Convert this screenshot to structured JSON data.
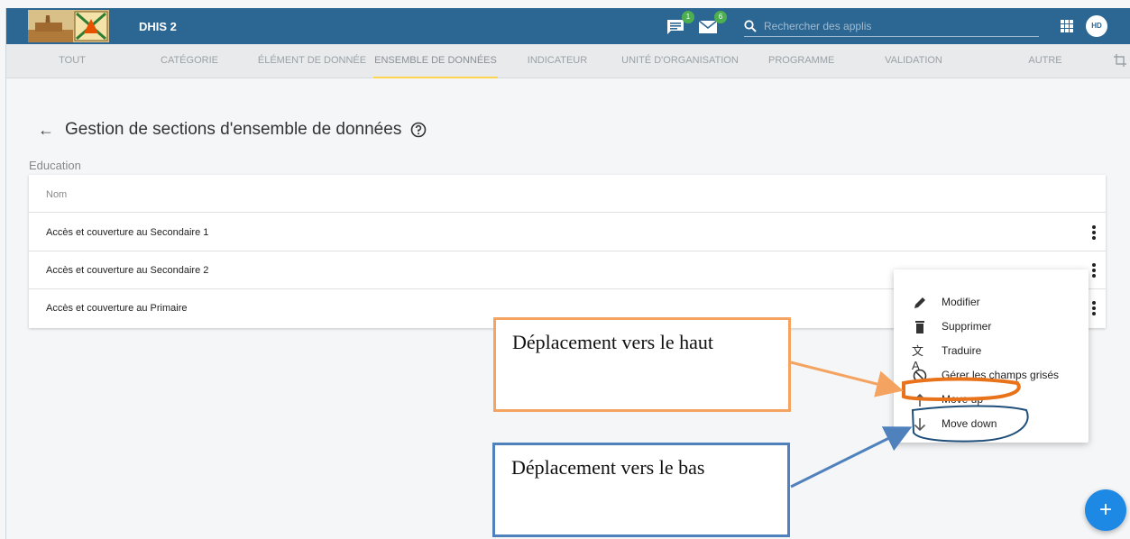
{
  "header": {
    "app_title": "DHIS 2",
    "interpretations_badge": "1",
    "messages_badge": "6",
    "search_placeholder": "Rechercher des applis",
    "avatar_initials": "HD"
  },
  "tabs": [
    {
      "label": "TOUT"
    },
    {
      "label": "CATÉGORIE"
    },
    {
      "label": "ÉLÉMENT DE DONNÉE"
    },
    {
      "label": "ENSEMBLE DE DONNÉES"
    },
    {
      "label": "INDICATEUR"
    },
    {
      "label": "UNITÉ D'ORGANISATION"
    },
    {
      "label": "PROGRAMME"
    },
    {
      "label": "VALIDATION"
    },
    {
      "label": "AUTRE"
    }
  ],
  "active_tab": "ENSEMBLE DE DONNÉES",
  "page": {
    "title": "Gestion de sections d'ensemble de données",
    "section_label": "Education"
  },
  "table": {
    "column_header": "Nom",
    "rows": [
      {
        "name": "Accès et couverture au Secondaire 1"
      },
      {
        "name": "Accès et couverture au Secondaire 2"
      },
      {
        "name": "Accès et couverture au Primaire"
      }
    ]
  },
  "context_menu": {
    "items": [
      {
        "label": "Modifier",
        "icon": "pencil-icon"
      },
      {
        "label": "Supprimer",
        "icon": "trash-icon"
      },
      {
        "label": "Traduire",
        "icon": "translate-icon"
      },
      {
        "label": "Gérer les champs grisés",
        "icon": "block-icon"
      },
      {
        "label": "Move up",
        "icon": "arrow-up-icon"
      },
      {
        "label": "Move down",
        "icon": "arrow-down-icon"
      }
    ]
  },
  "fab_label": "+",
  "annotations": {
    "up_text": "Déplacement vers le haut",
    "down_text": "Déplacement vers le bas",
    "up_color": "#f4a460",
    "down_color": "#4f81bd"
  },
  "colors": {
    "header_bg": "#2c6693",
    "active_tab_underline": "#ffd54f",
    "fab_bg": "#1e88e5"
  }
}
